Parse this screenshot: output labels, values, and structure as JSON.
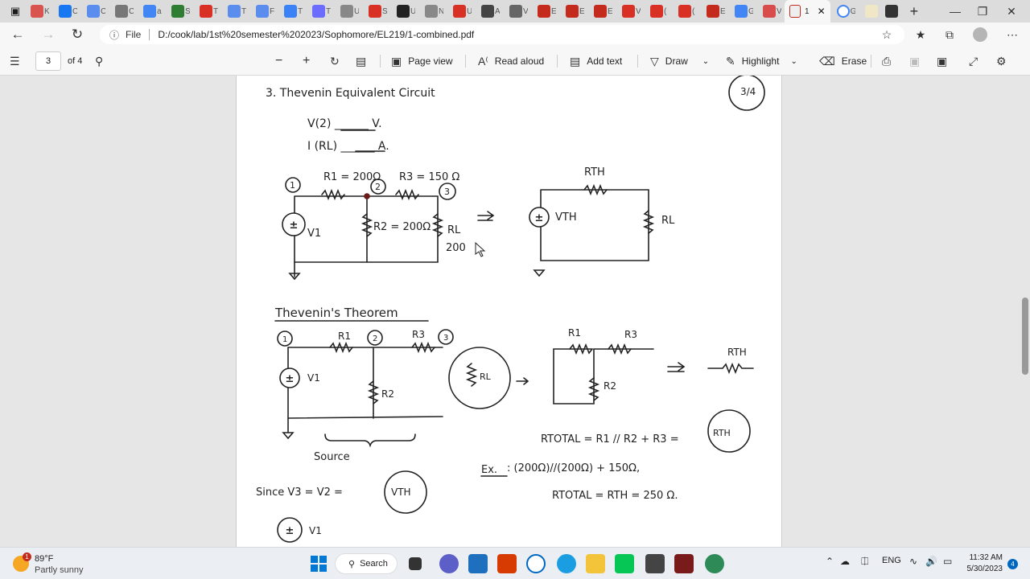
{
  "browser": {
    "tabs_inactive_labels": [
      "K",
      "C",
      "C",
      "C",
      "a",
      "S",
      "T",
      "T",
      "F",
      "T",
      "T",
      "U",
      "S",
      "U",
      "N",
      "U",
      "A",
      "V",
      "E",
      "E",
      "E",
      "V",
      "(",
      "(",
      "E",
      "G",
      "V"
    ],
    "active_tab_label": "1",
    "next_tab_label": "G",
    "url_scheme_label": "File",
    "url": "D:/cook/lab/1st%20semester%202023/Sophomore/EL219/1-combined.pdf"
  },
  "pdf_toolbar": {
    "page_number": "3",
    "page_count": "of 4",
    "page_view_label": "Page view",
    "read_aloud_label": "Read aloud",
    "add_text_label": "Add text",
    "draw_label": "Draw",
    "highlight_label": "Highlight",
    "erase_label": "Erase"
  },
  "document": {
    "heading": "3.  Thevenin Equivalent Circuit",
    "page_mark": "3/4",
    "v2_line": "V(2)  ______  V.",
    "irl_line": "I (RL)  ______  A.",
    "circuit1": {
      "r1": "R1 = 200Ω",
      "r3": "R3 = 150 Ω",
      "r2": "R2 = 200Ω",
      "rl": "RL",
      "rl_value": "200",
      "source": "V1",
      "node1": "1",
      "node2": "2",
      "node3": "3"
    },
    "equivalent": {
      "rth": "RTH",
      "vth": "VTH",
      "rl": "RL"
    },
    "theorem_heading": "Thevenin's Theorem",
    "circuit2": {
      "r1": "R1",
      "r3": "R3",
      "r2": "R2",
      "v1": "V1",
      "node1": "1",
      "node2": "2",
      "node3": "3",
      "source_label": "Source",
      "rl_circle": "RL"
    },
    "reduced": {
      "r1": "R1",
      "r3": "R3",
      "r2": "R2",
      "rth": "RTH"
    },
    "rtotal_eq": "RTOTAL = R1 // R2 + R3 =",
    "rtotal_circle": "RTH",
    "example_label": "Ex.",
    "example_expr": ": (200Ω)//(200Ω) + 150Ω,",
    "example_result": "RTOTAL = RTH = 250 Ω.",
    "since_line": "Since  V3 = V2 =",
    "vth_circle": "VTH",
    "bottom_v1": "V1"
  },
  "taskbar": {
    "weather_temp": "89°F",
    "weather_desc": "Partly sunny",
    "weather_badge": "1",
    "search_label": "Search",
    "language": "ENG",
    "time": "11:32 AM",
    "date": "5/30/2023",
    "notification_count": "4"
  },
  "colors": {
    "accent": "#0067c0",
    "tab_red": "#d93025",
    "pdf_red": "#c42b1c"
  }
}
